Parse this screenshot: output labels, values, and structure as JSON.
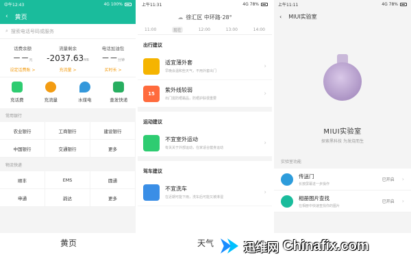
{
  "phone1": {
    "status_time": "中午12:43",
    "status_right": "4G 100%",
    "title": "黄页",
    "search_placeholder": "搜索电话号码或服务",
    "stats": [
      {
        "label": "话费余额",
        "value": "－－",
        "unit": "元",
        "link": "设定话费账 >"
      },
      {
        "label": "流量剩余",
        "value": "-2037.63",
        "unit": "MB",
        "link": "充流量 >"
      },
      {
        "label": "电话加油包",
        "value": "－－",
        "unit": "分钟",
        "link": "买时长 >"
      }
    ],
    "icons": [
      {
        "label": "充话费",
        "color": "#2ecc71"
      },
      {
        "label": "充流量",
        "color": "#f39c12"
      },
      {
        "label": "水煤电",
        "color": "#3498db"
      },
      {
        "label": "查发快递",
        "color": "#27ae60"
      }
    ],
    "section_banks": "常用银行",
    "banks": [
      "农业银行",
      "工商银行",
      "建设银行",
      "中国银行",
      "交通银行",
      "更多"
    ],
    "section_express": "物流快递",
    "express": [
      "顺丰",
      "EMS",
      "圆通",
      "申通",
      "韵达",
      "更多"
    ]
  },
  "phone2": {
    "status_time": "上午11:31",
    "status_right": "4G 78%",
    "location": "徐汇区 中环路·28°",
    "times": [
      "11:00",
      "现在",
      "12:00",
      "13:00",
      "14:00"
    ],
    "section_travel": "出行建议",
    "cards_travel": [
      {
        "title": "适宜薄外套",
        "sub": "早晚会温和些天气，不用外套出门",
        "color": "#f5b400",
        "icon": ""
      },
      {
        "title": "紫外线较弱",
        "sub": "出门需防晒霜品，防晒护肤很重要",
        "color": "#ff6b3d",
        "icon": "15"
      }
    ],
    "section_sport": "运动建议",
    "cards_sport": [
      {
        "title": "不宜室外运动",
        "sub": "有关关于外部运动，在家适合健身运动",
        "color": "#2ecc71",
        "icon": ""
      }
    ],
    "section_car": "驾车建议",
    "cards_car": [
      {
        "title": "不宜洗车",
        "sub": "在近期可能下雨，洗车后可能又被淋湿",
        "color": "#3a8ee6",
        "icon": ""
      }
    ]
  },
  "phone3": {
    "status_time": "上午11:11",
    "status_right": "4G 78%",
    "title": "MIUI实验室",
    "hero_title": "MIUI实验室",
    "hero_sub": "探索黑科技 为发烧而生",
    "section": "实验室功能",
    "items": [
      {
        "title": "传送门",
        "sub": "长按屏幕进一步操作",
        "status": "已开启",
        "color": "#2d9cdb"
      },
      {
        "title": "相册图片查找",
        "sub": "在相册中快速查找你的图片",
        "status": "已开启",
        "color": "#1abc9c"
      }
    ]
  },
  "captions": {
    "left": "黄页",
    "middle": "天气"
  },
  "watermark": {
    "cn": "迅维网",
    "en": "Chinafix.com"
  }
}
